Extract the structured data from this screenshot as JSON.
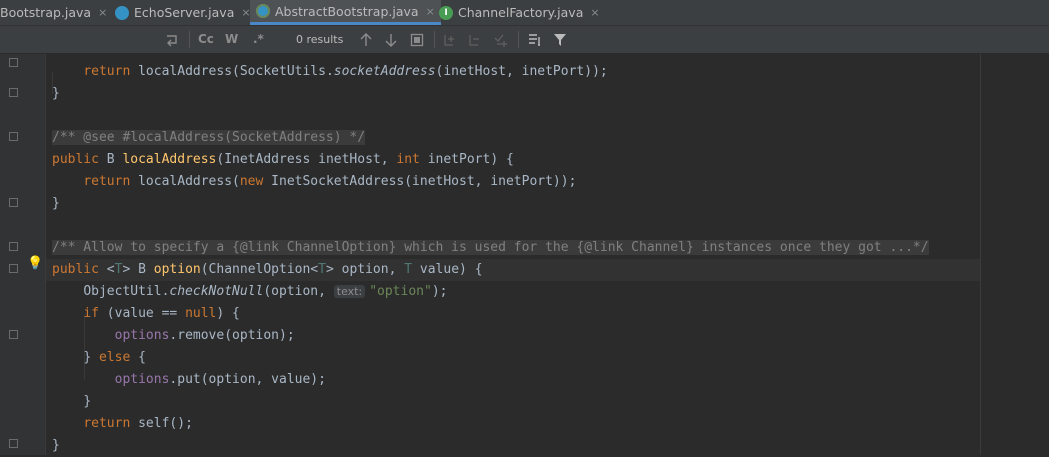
{
  "tabs": [
    {
      "label": "Bootstrap.java",
      "icon": "class-icon",
      "active": false
    },
    {
      "label": "EchoServer.java",
      "icon": "class-icon",
      "active": false
    },
    {
      "label": "AbstractBootstrap.java",
      "icon": "abstract-class-icon",
      "active": true
    },
    {
      "label": "ChannelFactory.java",
      "icon": "interface-icon",
      "active": false
    }
  ],
  "tab_close_glyph": "×",
  "search": {
    "match_case_label": "Cc",
    "words_label": "W",
    "regex_label": ".*",
    "results": "0 results"
  },
  "code": {
    "line1_indent": "    ",
    "line1_kw": "return",
    "line1_a": " localAddress(SocketUtils.",
    "line1_it": "socketAddress",
    "line1_b": "(inetHost, inetPort));",
    "brace_close": "}",
    "comment1": "/** @see #localAddress(SocketAddress) */",
    "l4_public": "public",
    "l4_b": " B ",
    "l4_fn": "localAddress",
    "l4_rest1": "(InetAddress inetHost, ",
    "l4_int": "int",
    "l4_rest2": " inetPort) {",
    "l5_return": "return",
    "l5_rest1": " localAddress(",
    "l5_new": "new",
    "l5_rest2": " InetSocketAddress(inetHost, inetPort));",
    "comment2": "/** Allow to specify a {@link ChannelOption} which is used for the {@link Channel} instances once they got ...*/",
    "l9_public": "public",
    "l9_a": " <",
    "l9_t": "T",
    "l9_b": "> B ",
    "l9_fn": "option",
    "l9_c": "(ChannelOption<",
    "l9_d": "T",
    "l9_e": "> option, ",
    "l9_f": "T",
    "l9_g": " value) {",
    "l10_a": "ObjectUtil.",
    "l10_it": "checkNotNull",
    "l10_b": "(option, ",
    "l10_hint": "text:",
    "l10_str": "\"option\"",
    "l10_c": ");",
    "l11_if": "if",
    "l11_a": " (value == ",
    "l11_null": "null",
    "l11_b": ") {",
    "l12_field": "options",
    "l12_a": ".remove(option);",
    "l13_a": "} ",
    "l13_else": "else",
    "l13_b": " {",
    "l14_field": "options",
    "l14_a": ".put(option, value);",
    "l15": "}",
    "l16_return": "return",
    "l16_a": " self();",
    "l17": "}"
  }
}
